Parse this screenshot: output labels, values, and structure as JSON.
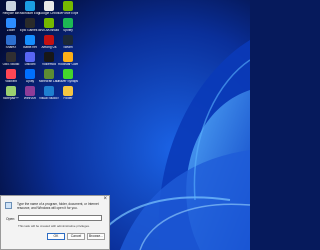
{
  "desktop": {
    "icons": [
      {
        "label": "Recycle Bin",
        "color": "#c9d3e0"
      },
      {
        "label": "Microsoft Edge",
        "color": "#1b9de2"
      },
      {
        "label": "Google Chrome",
        "color": "#e8e8e8"
      },
      {
        "label": "GeForce Experience",
        "color": "#76b900"
      },
      {
        "label": "Zoom",
        "color": "#2d8cff"
      },
      {
        "label": "Epic Games Launcher",
        "color": "#2a2a2a"
      },
      {
        "label": "NVIDIA Broadcast",
        "color": "#76b900"
      },
      {
        "label": "Spotify",
        "color": "#1db954"
      },
      {
        "label": "ShareX",
        "color": "#2d6fd0"
      },
      {
        "label": "Battle.net",
        "color": "#148eff"
      },
      {
        "label": "Among Us",
        "color": "#c51111"
      },
      {
        "label": "Steam",
        "color": "#1b2838"
      },
      {
        "label": "OBS Studio",
        "color": "#302e31"
      },
      {
        "label": "Discord",
        "color": "#5865f2"
      },
      {
        "label": "Voicemod",
        "color": "#171717"
      },
      {
        "label": "Rockstar Games",
        "color": "#fcaf17"
      },
      {
        "label": "Valorant",
        "color": "#ff4655"
      },
      {
        "label": "Uplay",
        "color": "#0070ff"
      },
      {
        "label": "Minecraft Launcher",
        "color": "#5d8c33"
      },
      {
        "label": "Razer Synapse",
        "color": "#44d62c"
      },
      {
        "label": "Notepad++",
        "color": "#9bd06f"
      },
      {
        "label": "WinRAR",
        "color": "#8e3c98"
      },
      {
        "label": "Visual Studio Code",
        "color": "#1e7fd0"
      },
      {
        "label": "Folder",
        "color": "#f4c542"
      }
    ]
  },
  "run_dialog": {
    "description": "Type the name of a program, folder, document, or Internet resource, and Windows will open it for you.",
    "open_label": "Open:",
    "input_value": "",
    "admin_note": "This task will be created with administrative privileges.",
    "ok_label": "OK",
    "cancel_label": "Cancel",
    "browse_label": "Browse..."
  }
}
